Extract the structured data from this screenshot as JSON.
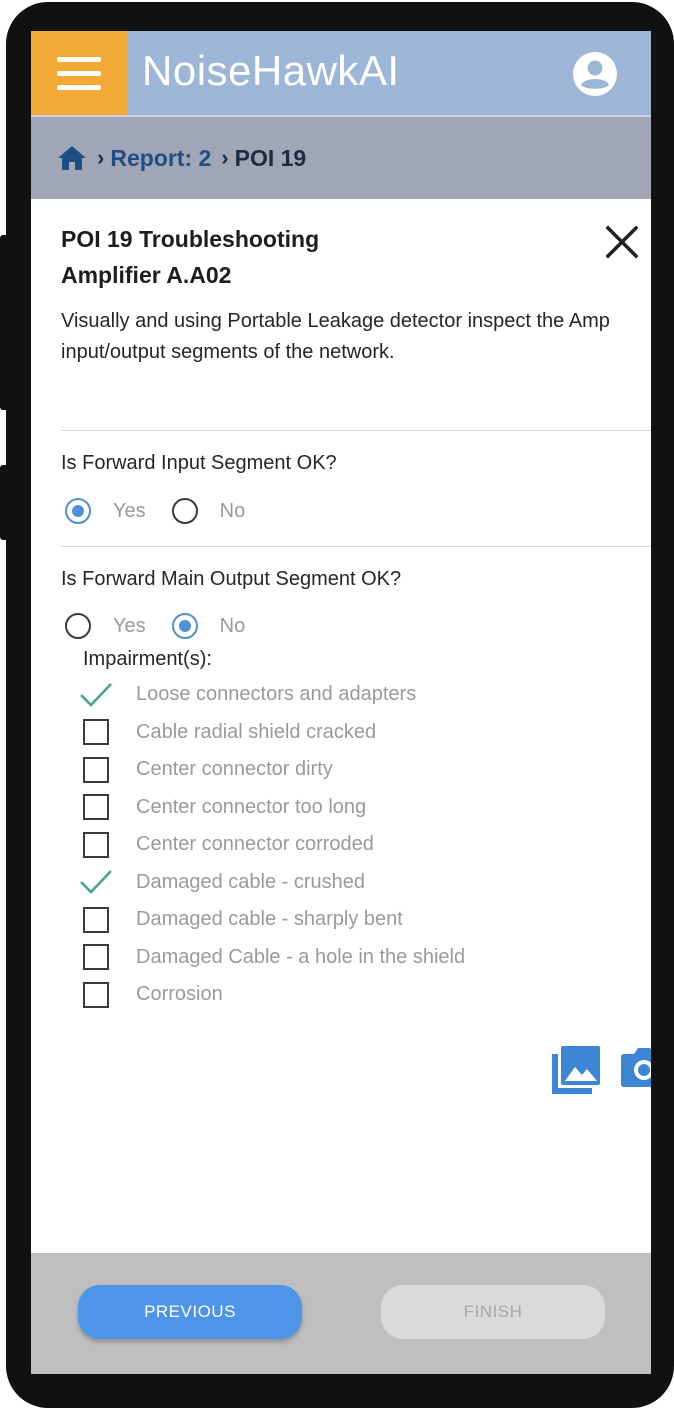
{
  "app": {
    "title": "NoiseHawkAI"
  },
  "breadcrumb": {
    "report": "Report: 2",
    "current": "POI 19",
    "separator": "›"
  },
  "poi": {
    "title_line1": "POI 19 Troubleshooting",
    "title_line2": "Amplifier A.A02",
    "instructions": "Visually and using Portable Leakage detector inspect the Amp input/output segments of the network."
  },
  "questions": [
    {
      "text": "Is Forward Input Segment OK?",
      "options": [
        "Yes",
        "No"
      ],
      "selected": "Yes"
    },
    {
      "text": "Is Forward Main Output Segment OK?",
      "options": [
        "Yes",
        "No"
      ],
      "selected": "No"
    }
  ],
  "impairments": {
    "heading": "Impairment(s):",
    "items": [
      {
        "label": "Loose connectors and adapters",
        "checked": true
      },
      {
        "label": "Cable radial shield cracked",
        "checked": false
      },
      {
        "label": "Center connector dirty",
        "checked": false
      },
      {
        "label": "Center connector too long",
        "checked": false
      },
      {
        "label": "Center connector corroded",
        "checked": false
      },
      {
        "label": "Damaged cable - crushed",
        "checked": true
      },
      {
        "label": "Damaged cable - sharply bent",
        "checked": false
      },
      {
        "label": "Damaged Cable - a hole in the shield",
        "checked": false
      },
      {
        "label": "Corrosion",
        "checked": false
      }
    ]
  },
  "footer": {
    "previous_label": "PREVIOUS",
    "finish_label": "FINISH"
  },
  "colors": {
    "menu_bg": "#f2a935",
    "header_bg": "#9db5d6",
    "breadcrumb_bg": "#a0a6b6",
    "accent_blue": "#4d94ea",
    "check_green": "#4aa58a"
  },
  "icons": [
    "hamburger-menu-icon",
    "account-circle-icon",
    "home-icon",
    "close-icon",
    "check-icon",
    "photo-gallery-icon",
    "camera-icon"
  ]
}
